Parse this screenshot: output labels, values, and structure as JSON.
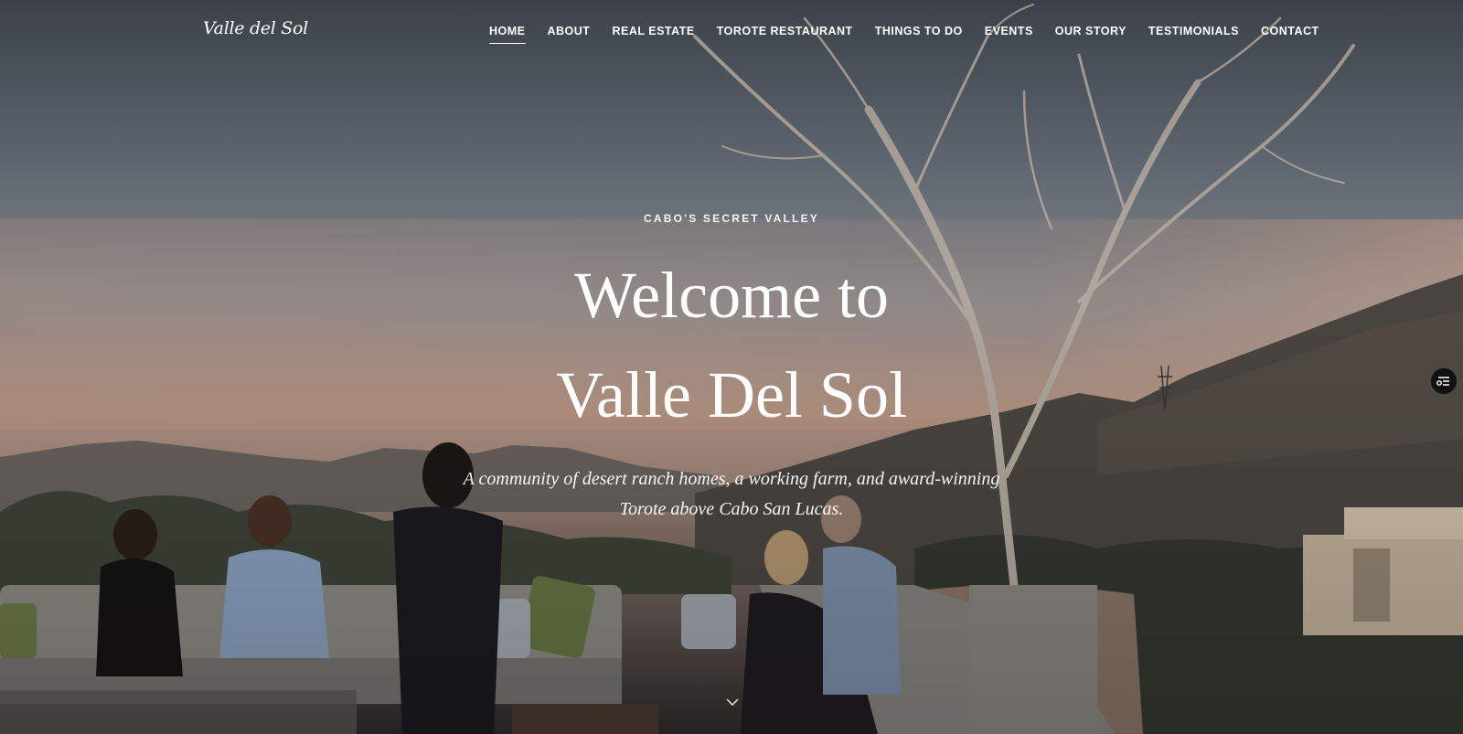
{
  "site": {
    "logo_text": "Valle del Sol"
  },
  "nav": {
    "items": [
      {
        "label": "HOME",
        "active": true
      },
      {
        "label": "ABOUT",
        "active": false
      },
      {
        "label": "REAL ESTATE",
        "active": false
      },
      {
        "label": "TOROTE RESTAURANT",
        "active": false
      },
      {
        "label": "THINGS TO DO",
        "active": false
      },
      {
        "label": "EVENTS",
        "active": false
      },
      {
        "label": "OUR STORY",
        "active": false
      },
      {
        "label": "TESTIMONIALS",
        "active": false
      },
      {
        "label": "CONTACT",
        "active": false
      }
    ]
  },
  "hero": {
    "eyebrow": "CABO'S SECRET VALLEY",
    "headline_line1": "Welcome to",
    "headline_line2": "Valle Del Sol",
    "subtitle_line1": "A community of desert ranch homes, a working farm, and award-winning",
    "subtitle_line2": "Torote above Cabo San Lucas.",
    "scroll_icon": "chevron-down-icon"
  },
  "widgets": {
    "side_icon": "accessibility-menu-icon"
  },
  "colors": {
    "text": "#ffffff",
    "sky_top": "#4a5058",
    "sky_horizon": "#c9a48c"
  }
}
